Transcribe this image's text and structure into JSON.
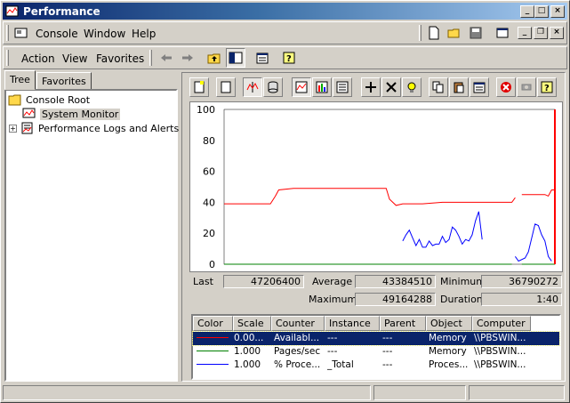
{
  "window": {
    "title": "Performance"
  },
  "menus": {
    "main": [
      "Console",
      "Window",
      "Help"
    ],
    "action": [
      "Action",
      "View",
      "Favorites"
    ]
  },
  "tabs": [
    "Tree",
    "Favorites"
  ],
  "tree": {
    "root": "Console Root",
    "items": [
      "System Monitor",
      "Performance Logs and Alerts"
    ]
  },
  "stats": {
    "last_label": "Last",
    "last": "47206400",
    "average_label": "Average",
    "average": "43384510",
    "minimum_label": "Minimum",
    "minimum": "36790272",
    "maximum_label": "Maximum",
    "maximum": "49164288",
    "duration_label": "Duration",
    "duration": "1:40"
  },
  "legend": {
    "headers": [
      "Color",
      "Scale",
      "Counter",
      "Instance",
      "Parent",
      "Object",
      "Computer"
    ],
    "rows": [
      {
        "color": "#ff0000",
        "scale": "0.00...",
        "counter": "Availabl...",
        "instance": "---",
        "parent": "---",
        "object": "Memory",
        "computer": "\\\\PBSWIN..."
      },
      {
        "color": "#008000",
        "scale": "1.000",
        "counter": "Pages/sec",
        "instance": "---",
        "parent": "---",
        "object": "Memory",
        "computer": "\\\\PBSWIN..."
      },
      {
        "color": "#0000ff",
        "scale": "1.000",
        "counter": "% Proce...",
        "instance": "_Total",
        "parent": "---",
        "object": "Proces...",
        "computer": "\\\\PBSWIN..."
      }
    ]
  },
  "chart_data": {
    "type": "line",
    "ylim": [
      0,
      100
    ],
    "yticks": [
      "100",
      "80",
      "60",
      "40",
      "20",
      "0"
    ],
    "cursor_x": 100,
    "series": [
      {
        "color": "#ff0000",
        "points": [
          [
            0,
            39
          ],
          [
            7,
            39
          ],
          [
            14,
            39
          ],
          [
            15.5,
            44
          ],
          [
            16.5,
            48
          ],
          [
            21,
            49
          ],
          [
            30,
            49
          ],
          [
            35,
            49
          ],
          [
            40,
            49
          ],
          [
            45,
            49
          ],
          [
            49,
            49
          ],
          [
            50,
            42
          ],
          [
            52,
            38
          ],
          [
            54,
            39
          ],
          [
            60,
            39
          ],
          [
            66,
            40
          ],
          [
            72,
            40
          ],
          [
            78,
            40
          ],
          [
            84,
            40
          ],
          [
            87,
            40
          ],
          [
            88,
            43
          ],
          [
            null,
            null
          ],
          [
            90,
            45
          ],
          [
            97,
            45
          ],
          [
            98,
            44
          ],
          [
            99,
            48
          ],
          [
            100,
            48
          ]
        ]
      },
      {
        "color": "#008000",
        "points": [
          [
            0,
            0
          ],
          [
            87,
            0
          ],
          [
            null,
            null
          ],
          [
            90,
            0
          ],
          [
            100,
            0
          ]
        ]
      },
      {
        "color": "#0000ff",
        "points": [
          [
            54,
            15
          ],
          [
            55,
            19
          ],
          [
            56,
            22
          ],
          [
            57,
            17
          ],
          [
            58,
            12
          ],
          [
            59,
            16
          ],
          [
            60,
            11
          ],
          [
            61,
            11
          ],
          [
            62,
            15
          ],
          [
            63,
            12
          ],
          [
            64,
            13
          ],
          [
            65,
            13
          ],
          [
            66,
            18
          ],
          [
            67,
            14
          ],
          [
            68,
            16
          ],
          [
            69,
            24
          ],
          [
            70,
            22
          ],
          [
            71,
            18
          ],
          [
            72,
            13
          ],
          [
            73,
            16
          ],
          [
            74,
            15
          ],
          [
            75,
            19
          ],
          [
            76,
            28
          ],
          [
            77,
            34
          ],
          [
            78,
            16
          ],
          [
            null,
            null
          ],
          [
            88,
            5
          ],
          [
            89,
            2
          ],
          [
            91,
            4
          ],
          [
            92,
            8
          ],
          [
            94,
            26
          ],
          [
            95,
            25
          ],
          [
            96,
            19
          ],
          [
            97,
            15
          ],
          [
            98,
            5
          ],
          [
            99,
            2
          ]
        ]
      }
    ]
  }
}
